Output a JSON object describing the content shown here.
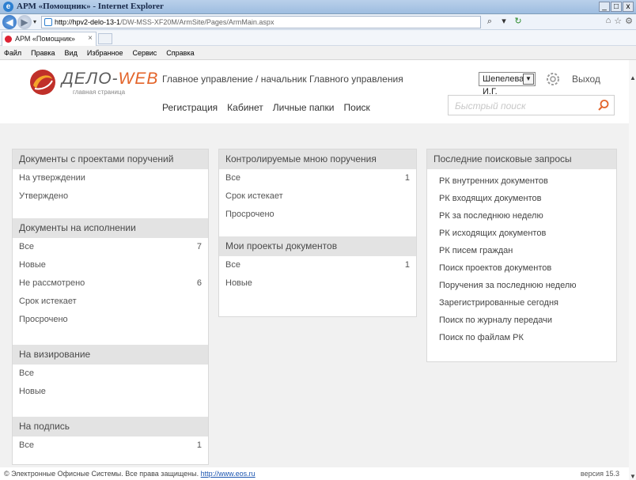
{
  "window": {
    "title": "АРМ «Помощник» - Internet Explorer",
    "buttons": [
      "_",
      "□",
      "x"
    ]
  },
  "address": {
    "url_host": "http://hpv2-delo-13-1",
    "url_path": "/DW-MSS-XF20M/ArmSite/Pages/ArmMain.aspx",
    "search_icon": "magnifier-icon"
  },
  "tab": {
    "title": "АРМ «Помощник»",
    "close": "×"
  },
  "menu": [
    "Файл",
    "Правка",
    "Вид",
    "Избранное",
    "Сервис",
    "Справка"
  ],
  "header": {
    "logo_main": "ДЕЛО-",
    "logo_accent": "WEB",
    "logo_sub": "главная страница",
    "org_path": "Главное управление / начальник Главного управления",
    "user": "Шепелева И.Г.",
    "logout": "Выход",
    "nav": [
      "Регистрация",
      "Кабинет",
      "Личные папки",
      "Поиск"
    ],
    "search_placeholder": "Быстрый поиск"
  },
  "colors": {
    "accent": "#e3642a",
    "panel_head": "#e3e3e3",
    "background": "#f1f1f1"
  },
  "col1": [
    {
      "title": "Документы с проектами поручений",
      "rows": [
        {
          "label": "На утверждении",
          "count": ""
        },
        {
          "label": "Утверждено",
          "count": ""
        }
      ]
    },
    {
      "title": "Документы на исполнении",
      "rows": [
        {
          "label": "Все",
          "count": "7"
        },
        {
          "label": "Новые",
          "count": ""
        },
        {
          "label": "Не рассмотрено",
          "count": "6"
        },
        {
          "label": "Срок истекает",
          "count": ""
        },
        {
          "label": "Просрочено",
          "count": ""
        }
      ]
    },
    {
      "title": "На визирование",
      "rows": [
        {
          "label": "Все",
          "count": ""
        },
        {
          "label": "Новые",
          "count": ""
        }
      ]
    },
    {
      "title": "На подпись",
      "rows": [
        {
          "label": "Все",
          "count": "1"
        }
      ]
    }
  ],
  "col2": [
    {
      "title": "Контролируемые мною поручения",
      "rows": [
        {
          "label": "Все",
          "count": "1"
        },
        {
          "label": "Срок истекает",
          "count": ""
        },
        {
          "label": "Просрочено",
          "count": ""
        }
      ]
    },
    {
      "title": "Мои проекты документов",
      "rows": [
        {
          "label": "Все",
          "count": "1"
        },
        {
          "label": "Новые",
          "count": ""
        }
      ]
    }
  ],
  "col3": {
    "title": "Последние поисковые запросы",
    "items": [
      "РК внутренних документов",
      "РК входящих документов",
      "РК за последнюю неделю",
      "РК исходящих документов",
      "РК писем граждан",
      "Поиск проектов документов",
      "Поручения за последнюю неделю",
      "Зарегистрированные сегодня",
      "Поиск по журналу передачи",
      "Поиск по файлам РК"
    ]
  },
  "footer": {
    "copyright": "© Электронные Офисные Системы. Все права защищены.",
    "link": "http://www.eos.ru",
    "version": "версия 15.3"
  }
}
